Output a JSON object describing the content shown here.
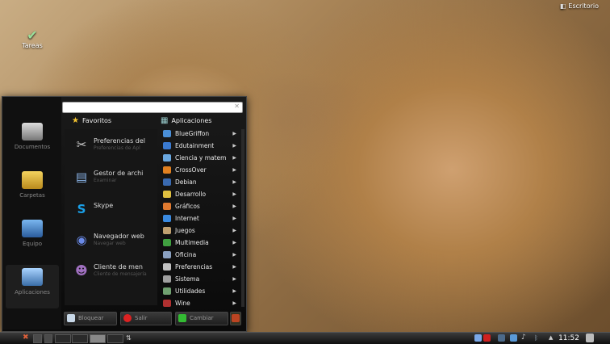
{
  "desktop": {
    "icon_tareas": "Tareas",
    "icon_escritorio": "Escritorio"
  },
  "menu": {
    "places": [
      {
        "label": "Documentos"
      },
      {
        "label": "Carpetas"
      },
      {
        "label": "Equipo"
      },
      {
        "label": "Aplicaciones"
      }
    ],
    "search": {
      "value": "",
      "placeholder": ""
    },
    "favorites_header": "Favoritos",
    "applications_header": "Aplicaciones",
    "favorites": [
      {
        "title": "Preferencias del",
        "subtitle": "Preferencias de Apl"
      },
      {
        "title": "Gestor de archi",
        "subtitle": "Examinar"
      },
      {
        "title": "Skype",
        "subtitle": ""
      },
      {
        "title": "Navegador web",
        "subtitle": "Navegar web"
      },
      {
        "title": "Cliente de men",
        "subtitle": "Cliente de mensajería"
      }
    ],
    "applications": [
      {
        "label": "BlueGriffon",
        "color": "#4a8fd8"
      },
      {
        "label": "Edutainment",
        "color": "#3a7ad0"
      },
      {
        "label": "Ciencia y matem",
        "color": "#6aa8e0"
      },
      {
        "label": "CrossOver",
        "color": "#e08020"
      },
      {
        "label": "Debian",
        "color": "#3a6ab0"
      },
      {
        "label": "Desarrollo",
        "color": "#e0c040"
      },
      {
        "label": "Gráficos",
        "color": "#e07a30"
      },
      {
        "label": "Internet",
        "color": "#3a8ae0"
      },
      {
        "label": "Juegos",
        "color": "#c0a070"
      },
      {
        "label": "Multimedia",
        "color": "#40a040"
      },
      {
        "label": "Oficina",
        "color": "#8aa0c0"
      },
      {
        "label": "Preferencias",
        "color": "#c0c0c0"
      },
      {
        "label": "Sistema",
        "color": "#a0a0a0"
      },
      {
        "label": "Utilidades",
        "color": "#70a070"
      },
      {
        "label": "Wine",
        "color": "#b03030"
      }
    ],
    "buttons": {
      "lock": "Bloquear",
      "logout": "Salir",
      "switch": "Cambiar"
    }
  },
  "taskbar": {
    "clock": "11:52"
  }
}
